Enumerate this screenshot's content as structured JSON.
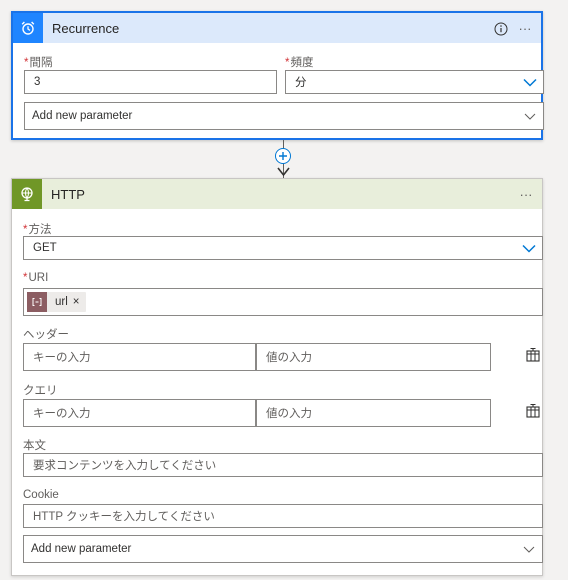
{
  "recurrence": {
    "title": "Recurrence",
    "interval_label": "間隔",
    "interval_value": "3",
    "frequency_label": "頻度",
    "frequency_value": "分",
    "add_param": "Add new parameter"
  },
  "http": {
    "title": "HTTP",
    "method_label": "方法",
    "method_value": "GET",
    "uri_label": "URI",
    "uri_token": "url",
    "headers_label": "ヘッダー",
    "headers_key_ph": "キーの入力",
    "headers_val_ph": "値の入力",
    "query_label": "クエリ",
    "query_key_ph": "キーの入力",
    "query_val_ph": "値の入力",
    "body_label": "本文",
    "body_ph": "要求コンテンツを入力してください",
    "cookie_label": "Cookie",
    "cookie_ph": "HTTP クッキーを入力してください",
    "add_param": "Add new parameter"
  },
  "common": {
    "required_mark": "*",
    "more": "···",
    "token_close": "×"
  },
  "colors": {
    "recurrence_accent": "#1f85ff",
    "recurrence_header_bg": "#dce9fb",
    "selected_border": "#1a73e8",
    "http_accent": "#709727",
    "http_header_bg": "#e8eedb",
    "token_icon_bg": "#8c5d62",
    "required_red": "#d13438"
  },
  "icons": {
    "recurrence": "alarm-clock-icon",
    "http": "globe-icon",
    "info": "info-icon",
    "add": "plus-circle-icon",
    "dropdown": "chevron-down-icon",
    "switch_mode": "switch-to-text-mode-icon",
    "token": "variable-icon"
  }
}
